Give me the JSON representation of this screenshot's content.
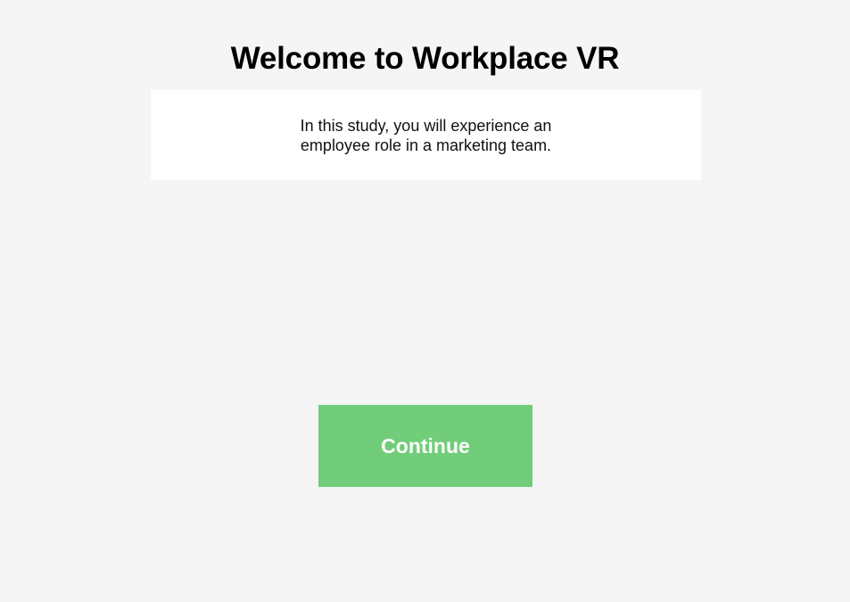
{
  "welcome": {
    "title": "Welcome to Workplace VR",
    "intro": "In this study, you will experience an employee role in a marketing team."
  },
  "actions": {
    "continue_label": "Continue"
  },
  "colors": {
    "background": "#f5f5f5",
    "card": "#ffffff",
    "accent": "#72cd7a",
    "button_text": "#ffffff"
  }
}
